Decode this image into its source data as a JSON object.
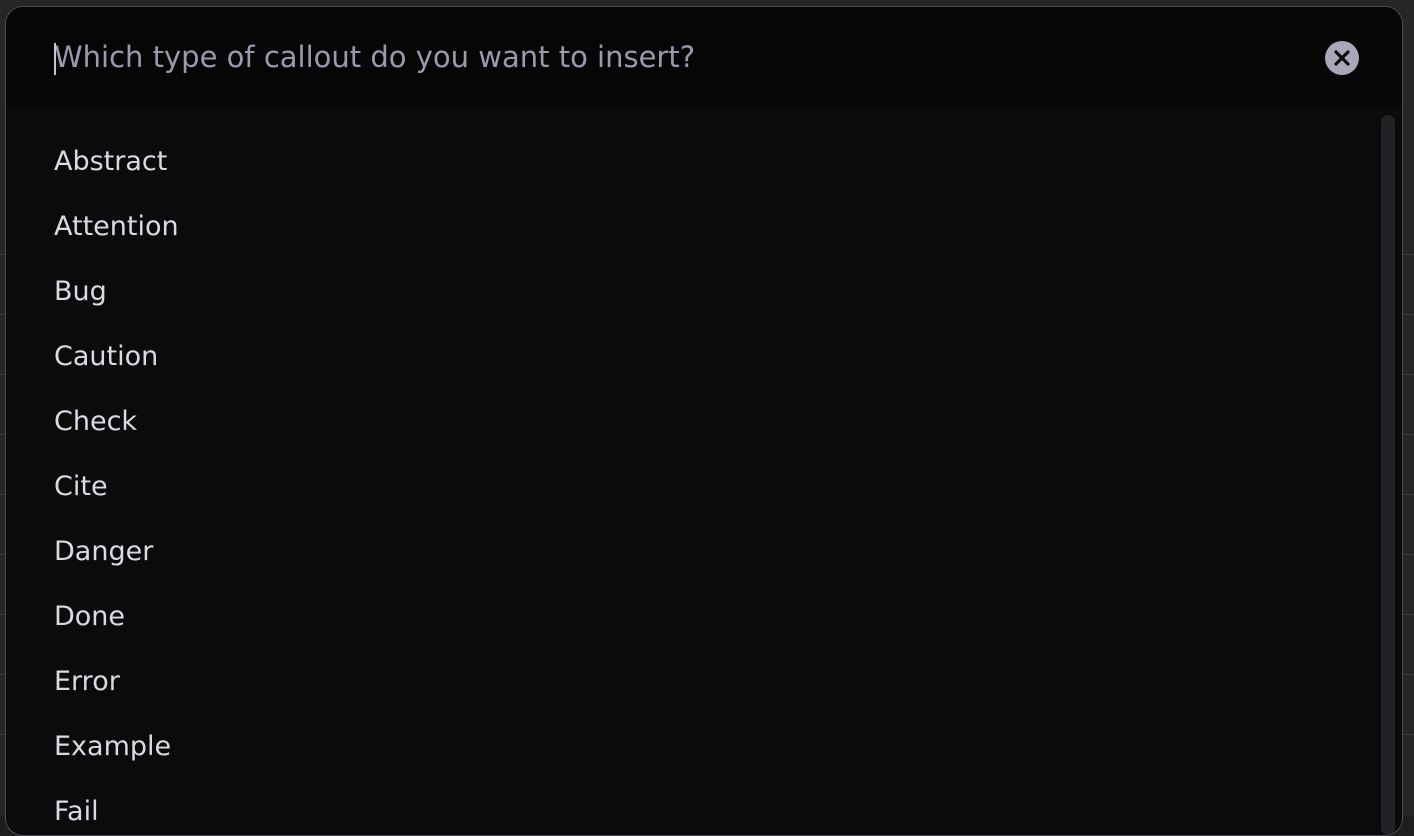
{
  "prompt": {
    "placeholder": "Which type of callout do you want to insert?",
    "value": ""
  },
  "close_button": {
    "icon": "close-icon"
  },
  "suggestions": [
    "Abstract",
    "Attention",
    "Bug",
    "Caution",
    "Check",
    "Cite",
    "Danger",
    "Done",
    "Error",
    "Example",
    "Fail"
  ],
  "colors": {
    "modal_bg": "#0b0b0c",
    "prompt_bg": "#060607",
    "text": "#dadae4",
    "placeholder": "#9a9aac",
    "close_button_bg": "#a8a8b8"
  }
}
